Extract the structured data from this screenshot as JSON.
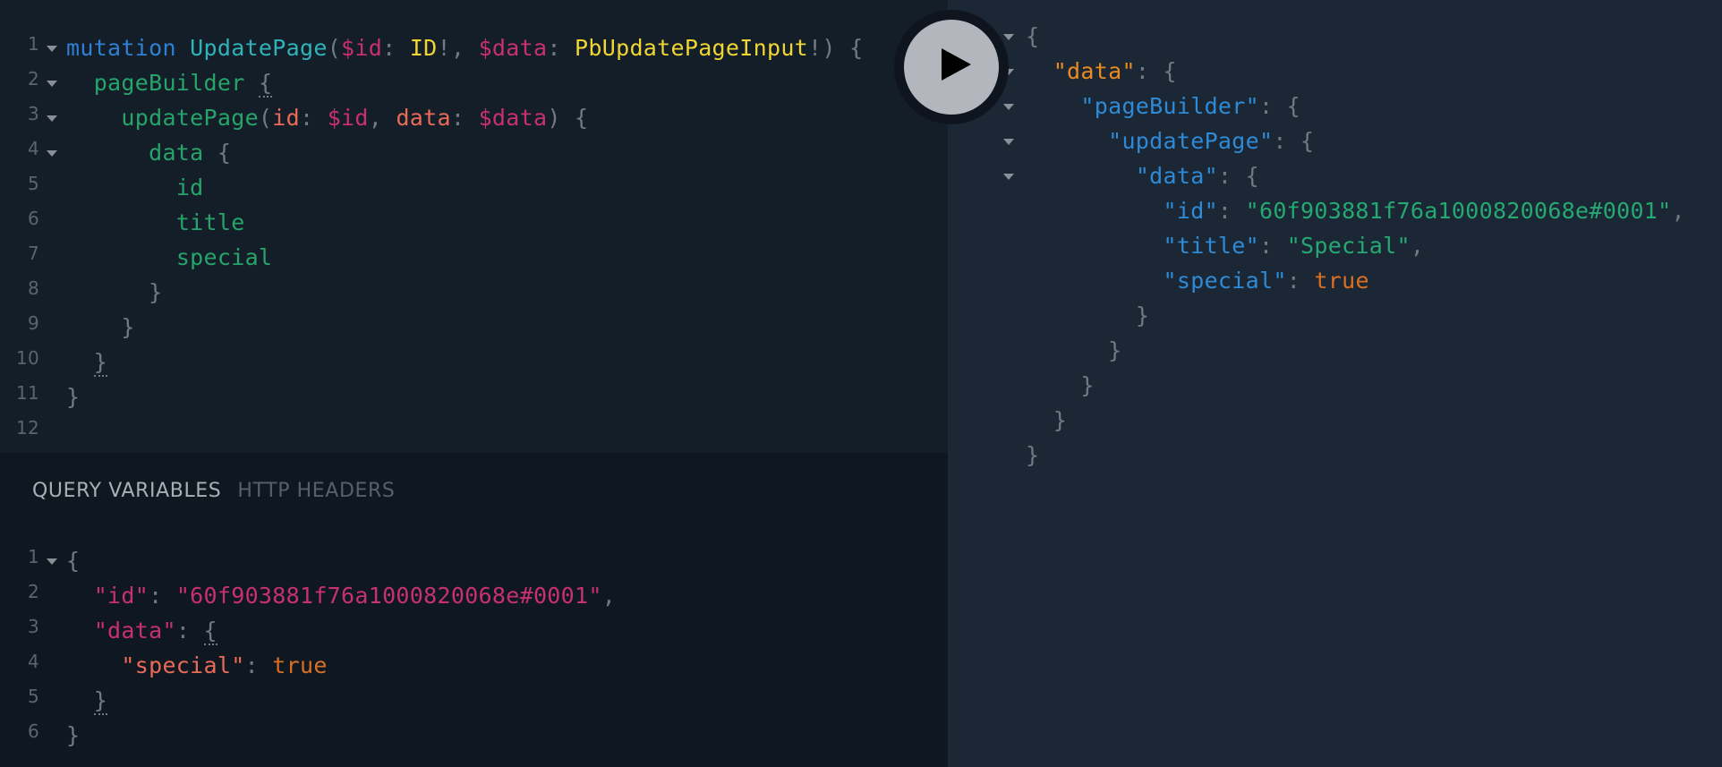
{
  "query_editor": {
    "lines": [
      {
        "n": "1",
        "fold": true,
        "indent": "",
        "tokens": [
          {
            "t": "mutation",
            "c": "kw"
          },
          {
            "t": " ",
            "c": "punc"
          },
          {
            "t": "UpdatePage",
            "c": "def"
          },
          {
            "t": "(",
            "c": "punc"
          },
          {
            "t": "$id",
            "c": "var"
          },
          {
            "t": ": ",
            "c": "punc"
          },
          {
            "t": "ID",
            "c": "type"
          },
          {
            "t": "!, ",
            "c": "punc"
          },
          {
            "t": "$data",
            "c": "var"
          },
          {
            "t": ": ",
            "c": "punc"
          },
          {
            "t": "PbUpdatePageInput",
            "c": "type"
          },
          {
            "t": "!) {",
            "c": "punc"
          }
        ]
      },
      {
        "n": "2",
        "fold": true,
        "indent": "  ",
        "tokens": [
          {
            "t": "pageBuilder",
            "c": "field"
          },
          {
            "t": " ",
            "c": "punc"
          },
          {
            "t": "{",
            "c": "punc match"
          }
        ]
      },
      {
        "n": "3",
        "fold": true,
        "indent": "    ",
        "tokens": [
          {
            "t": "updatePage",
            "c": "field"
          },
          {
            "t": "(",
            "c": "punc"
          },
          {
            "t": "id",
            "c": "arg"
          },
          {
            "t": ": ",
            "c": "punc"
          },
          {
            "t": "$id",
            "c": "var"
          },
          {
            "t": ", ",
            "c": "punc"
          },
          {
            "t": "data",
            "c": "arg"
          },
          {
            "t": ": ",
            "c": "punc"
          },
          {
            "t": "$data",
            "c": "var"
          },
          {
            "t": ") {",
            "c": "punc"
          }
        ]
      },
      {
        "n": "4",
        "fold": true,
        "indent": "      ",
        "tokens": [
          {
            "t": "data",
            "c": "field"
          },
          {
            "t": " {",
            "c": "punc"
          }
        ]
      },
      {
        "n": "5",
        "fold": false,
        "indent": "        ",
        "tokens": [
          {
            "t": "id",
            "c": "field"
          }
        ]
      },
      {
        "n": "6",
        "fold": false,
        "indent": "        ",
        "tokens": [
          {
            "t": "title",
            "c": "field"
          }
        ]
      },
      {
        "n": "7",
        "fold": false,
        "indent": "        ",
        "tokens": [
          {
            "t": "special",
            "c": "field"
          }
        ]
      },
      {
        "n": "8",
        "fold": false,
        "indent": "      ",
        "tokens": [
          {
            "t": "}",
            "c": "punc"
          }
        ]
      },
      {
        "n": "9",
        "fold": false,
        "indent": "    ",
        "tokens": [
          {
            "t": "}",
            "c": "punc"
          }
        ]
      },
      {
        "n": "10",
        "fold": false,
        "indent": "  ",
        "tokens": [
          {
            "t": "}",
            "c": "punc match"
          }
        ]
      },
      {
        "n": "11",
        "fold": false,
        "indent": "",
        "tokens": [
          {
            "t": "}",
            "c": "punc"
          }
        ]
      },
      {
        "n": "12",
        "fold": false,
        "indent": "",
        "tokens": []
      }
    ]
  },
  "run_button": {
    "icon": "play-icon",
    "label": "Execute Query"
  },
  "variables_panel": {
    "tabs": [
      {
        "label": "QUERY VARIABLES",
        "active": true
      },
      {
        "label": "HTTP HEADERS",
        "active": false
      }
    ],
    "lines": [
      {
        "n": "1",
        "fold": true,
        "indent": "",
        "tokens": [
          {
            "t": "{",
            "c": "punc"
          }
        ]
      },
      {
        "n": "2",
        "fold": false,
        "indent": "  ",
        "tokens": [
          {
            "t": "\"id\"",
            "c": "str"
          },
          {
            "t": ": ",
            "c": "punc"
          },
          {
            "t": "\"60f903881f76a1000820068e#0001\"",
            "c": "str"
          },
          {
            "t": ",",
            "c": "punc"
          }
        ]
      },
      {
        "n": "3",
        "fold": false,
        "indent": "  ",
        "tokens": [
          {
            "t": "\"data\"",
            "c": "str"
          },
          {
            "t": ": ",
            "c": "punc"
          },
          {
            "t": "{",
            "c": "punc match"
          }
        ]
      },
      {
        "n": "4",
        "fold": false,
        "indent": "    ",
        "tokens": [
          {
            "t": "\"special\"",
            "c": "arg"
          },
          {
            "t": ": ",
            "c": "punc"
          },
          {
            "t": "true",
            "c": "bool"
          }
        ]
      },
      {
        "n": "5",
        "fold": false,
        "indent": "  ",
        "tokens": [
          {
            "t": "}",
            "c": "punc match"
          }
        ]
      },
      {
        "n": "6",
        "fold": false,
        "indent": "",
        "tokens": [
          {
            "t": "}",
            "c": "punc"
          }
        ]
      }
    ]
  },
  "result_panel": {
    "lines": [
      {
        "fold": true,
        "indent": "",
        "tokens": [
          {
            "t": "{",
            "c": "punc"
          }
        ]
      },
      {
        "fold": true,
        "indent": "  ",
        "tokens": [
          {
            "t": "\"data\"",
            "c": "rkey-top"
          },
          {
            "t": ": {",
            "c": "punc"
          }
        ]
      },
      {
        "fold": true,
        "indent": "    ",
        "tokens": [
          {
            "t": "\"pageBuilder\"",
            "c": "rkey"
          },
          {
            "t": ": {",
            "c": "punc"
          }
        ]
      },
      {
        "fold": true,
        "indent": "      ",
        "tokens": [
          {
            "t": "\"updatePage\"",
            "c": "rkey"
          },
          {
            "t": ": {",
            "c": "punc"
          }
        ]
      },
      {
        "fold": true,
        "indent": "        ",
        "tokens": [
          {
            "t": "\"data\"",
            "c": "rkey"
          },
          {
            "t": ": {",
            "c": "punc"
          }
        ]
      },
      {
        "fold": false,
        "indent": "          ",
        "tokens": [
          {
            "t": "\"id\"",
            "c": "rkey"
          },
          {
            "t": ": ",
            "c": "punc"
          },
          {
            "t": "\"60f903881f76a1000820068e#0001\"",
            "c": "rstr"
          },
          {
            "t": ",",
            "c": "punc"
          }
        ]
      },
      {
        "fold": false,
        "indent": "          ",
        "tokens": [
          {
            "t": "\"title\"",
            "c": "rkey"
          },
          {
            "t": ": ",
            "c": "punc"
          },
          {
            "t": "\"Special\"",
            "c": "rstr"
          },
          {
            "t": ",",
            "c": "punc"
          }
        ]
      },
      {
        "fold": false,
        "indent": "          ",
        "tokens": [
          {
            "t": "\"special\"",
            "c": "rkey"
          },
          {
            "t": ": ",
            "c": "punc"
          },
          {
            "t": "true",
            "c": "bool"
          }
        ]
      },
      {
        "fold": false,
        "indent": "        ",
        "tokens": [
          {
            "t": "}",
            "c": "punc"
          }
        ]
      },
      {
        "fold": false,
        "indent": "      ",
        "tokens": [
          {
            "t": "}",
            "c": "punc"
          }
        ]
      },
      {
        "fold": false,
        "indent": "    ",
        "tokens": [
          {
            "t": "}",
            "c": "punc"
          }
        ]
      },
      {
        "fold": false,
        "indent": "  ",
        "tokens": [
          {
            "t": "}",
            "c": "punc"
          }
        ]
      },
      {
        "fold": false,
        "indent": "",
        "tokens": [
          {
            "t": "}",
            "c": "punc"
          }
        ]
      }
    ]
  }
}
